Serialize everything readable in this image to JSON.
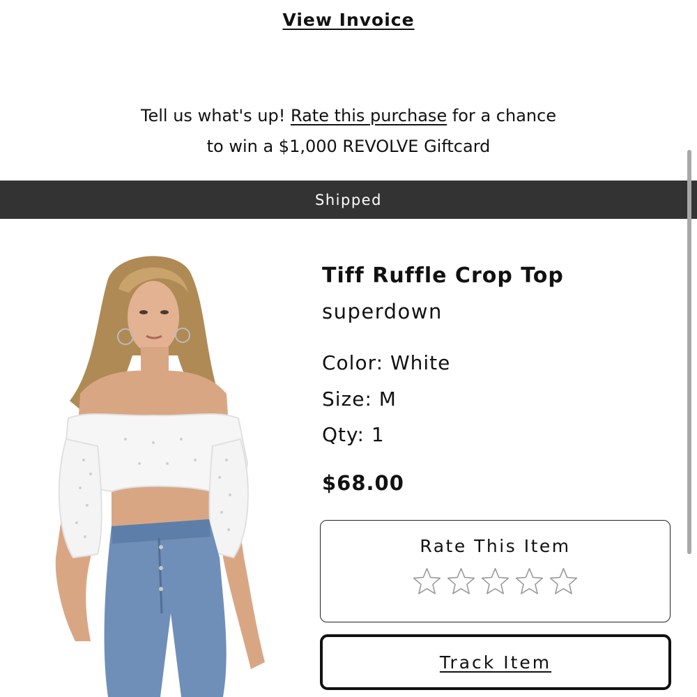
{
  "invoice": {
    "link_label": "View Invoice"
  },
  "promo": {
    "text_before": "Tell us what's up! ",
    "link_label": "Rate this purchase",
    "text_after": " for a chance",
    "line2": "to win a $1,000 REVOLVE Giftcard"
  },
  "order_status": {
    "label": "Shipped"
  },
  "product": {
    "name": "Tiff Ruffle Crop Top",
    "brand": "superdown",
    "color": "Color: White",
    "size": "Size: M",
    "qty": "Qty: 1",
    "price": "$68.00",
    "image_icon": "product-photo"
  },
  "rating": {
    "title": "Rate This Item",
    "max_stars": 5,
    "current_rating": 0,
    "star_icon": "star-outline-icon"
  },
  "track": {
    "label": "Track Item"
  },
  "colors": {
    "status_bar_bg": "#333333",
    "text": "#111111",
    "star_outline": "#9a9a9a"
  }
}
